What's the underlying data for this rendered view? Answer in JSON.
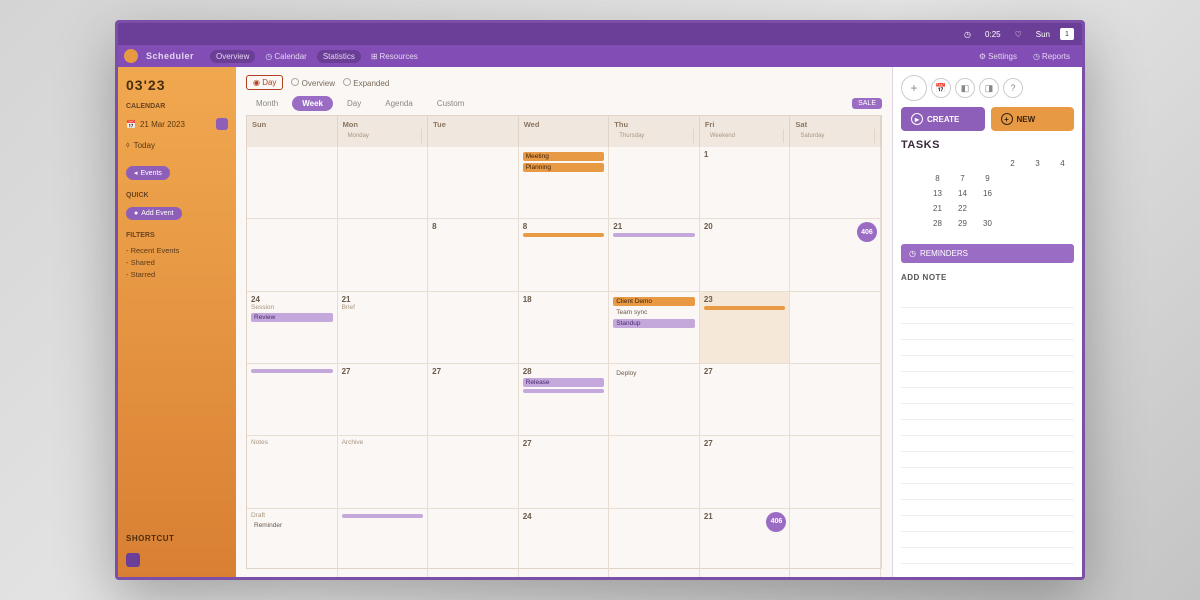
{
  "colors": {
    "purple": "#8e5fb8",
    "orange": "#e89944",
    "purple_dark": "#6b3f97"
  },
  "titlebar": {
    "items": [
      "0:25",
      "Sun"
    ],
    "profile": "1"
  },
  "menubar": {
    "brand": "Scheduler",
    "items": [
      "Overview",
      "Calendar",
      "Statistics",
      "Resources",
      "Settings",
      "Reports"
    ]
  },
  "sidebar": {
    "month": "03'23",
    "section1": "CALENDAR",
    "date_row": "21 Mar 2023",
    "tag": "Today",
    "nav_label": "Events",
    "add_label": "Add Event",
    "section2": "QUICK",
    "section3": "FILTERS",
    "filters": [
      "Recent Events",
      "Shared",
      "Starred"
    ],
    "footer": "SHORTCUT"
  },
  "toolbar": {
    "tabs": [
      "Day",
      "Overview",
      "Expanded"
    ],
    "views": [
      "Month",
      "Week",
      "Day",
      "Agenda",
      "Custom"
    ],
    "active_view": "Week",
    "sale_tag": "SALE"
  },
  "calendar": {
    "headers": [
      "Sun",
      "Mon",
      "Tue",
      "Wed",
      "Thu",
      "Fri",
      "Sat"
    ],
    "subheaders": [
      "",
      "Monday",
      "",
      "",
      "Thursday",
      "Weekend",
      "Saturday"
    ],
    "weeks": [
      [
        {
          "n": ""
        },
        {
          "n": ""
        },
        {
          "n": ""
        },
        {
          "n": "",
          "ev": [
            {
              "t": "Meeting",
              "c": "or"
            },
            {
              "t": "Planning",
              "c": "or"
            }
          ]
        },
        {
          "n": ""
        },
        {
          "n": "1"
        },
        {
          "n": ""
        }
      ],
      [
        {
          "n": ""
        },
        {
          "n": ""
        },
        {
          "n": "8"
        },
        {
          "n": "8",
          "ev": [
            {
              "t": "",
              "c": "or",
              "bar": true
            }
          ]
        },
        {
          "n": "21",
          "ev": [
            {
              "t": "",
              "c": "pu",
              "bar": true
            }
          ]
        },
        {
          "n": "20"
        },
        {
          "n": "",
          "badge": "406"
        }
      ],
      [
        {
          "n": "24",
          "sub": "Session",
          "ev": [
            {
              "t": "Review",
              "c": "pu"
            }
          ]
        },
        {
          "n": "21",
          "sub": "Brief"
        },
        {
          "n": ""
        },
        {
          "n": "18"
        },
        {
          "n": "",
          "ev": [
            {
              "t": "Client Demo",
              "c": "or"
            },
            {
              "t": "Team sync",
              "c": "txt"
            },
            {
              "t": "Standup",
              "c": "pu"
            }
          ]
        },
        {
          "n": "23",
          "hl": true,
          "ev": [
            {
              "t": "",
              "c": "or",
              "bar": true
            }
          ]
        },
        {
          "n": ""
        }
      ],
      [
        {
          "n": "",
          "ev": [
            {
              "t": "",
              "c": "pu",
              "bar": true
            }
          ]
        },
        {
          "n": "27"
        },
        {
          "n": "27"
        },
        {
          "n": "28",
          "ev": [
            {
              "t": "Release",
              "c": "pu"
            },
            {
              "t": "",
              "c": "pu",
              "bar": true
            }
          ]
        },
        {
          "n": "",
          "ev": [
            {
              "t": "Deploy",
              "c": "txt"
            }
          ]
        },
        {
          "n": "27"
        },
        {
          "n": ""
        }
      ],
      [
        {
          "n": "",
          "sub": "Notes"
        },
        {
          "n": "",
          "sub": "Archive"
        },
        {
          "n": ""
        },
        {
          "n": "27"
        },
        {
          "n": ""
        },
        {
          "n": "27"
        },
        {
          "n": ""
        }
      ],
      [
        {
          "n": "",
          "sub": "Draft",
          "ev": [
            {
              "t": "Reminder",
              "c": "txt"
            }
          ]
        },
        {
          "n": "",
          "ev": [
            {
              "t": "",
              "c": "pu",
              "bar": true
            }
          ]
        },
        {
          "n": ""
        },
        {
          "n": "24"
        },
        {
          "n": ""
        },
        {
          "n": "21",
          "badge": "406"
        },
        {
          "n": ""
        }
      ]
    ]
  },
  "rightpanel": {
    "icons": [
      "+",
      "📅",
      "◧",
      "◨",
      "?"
    ],
    "primary_btn": "CREATE",
    "secondary_btn": "NEW",
    "tasks_title": "TASKS",
    "mini_cal": [
      [
        "",
        "",
        "",
        "",
        "2",
        "3",
        "4"
      ],
      [
        "",
        "8",
        "7",
        "9",
        "",
        "",
        ""
      ],
      [
        "",
        "13",
        "14",
        "16",
        "",
        "",
        ""
      ],
      [
        "",
        "21",
        "22",
        "",
        "",
        "",
        ""
      ],
      [
        "",
        "28",
        "29",
        "30",
        "",
        "",
        ""
      ]
    ],
    "reminders_label": "REMINDERS",
    "notes_label": "ADD NOTE"
  }
}
